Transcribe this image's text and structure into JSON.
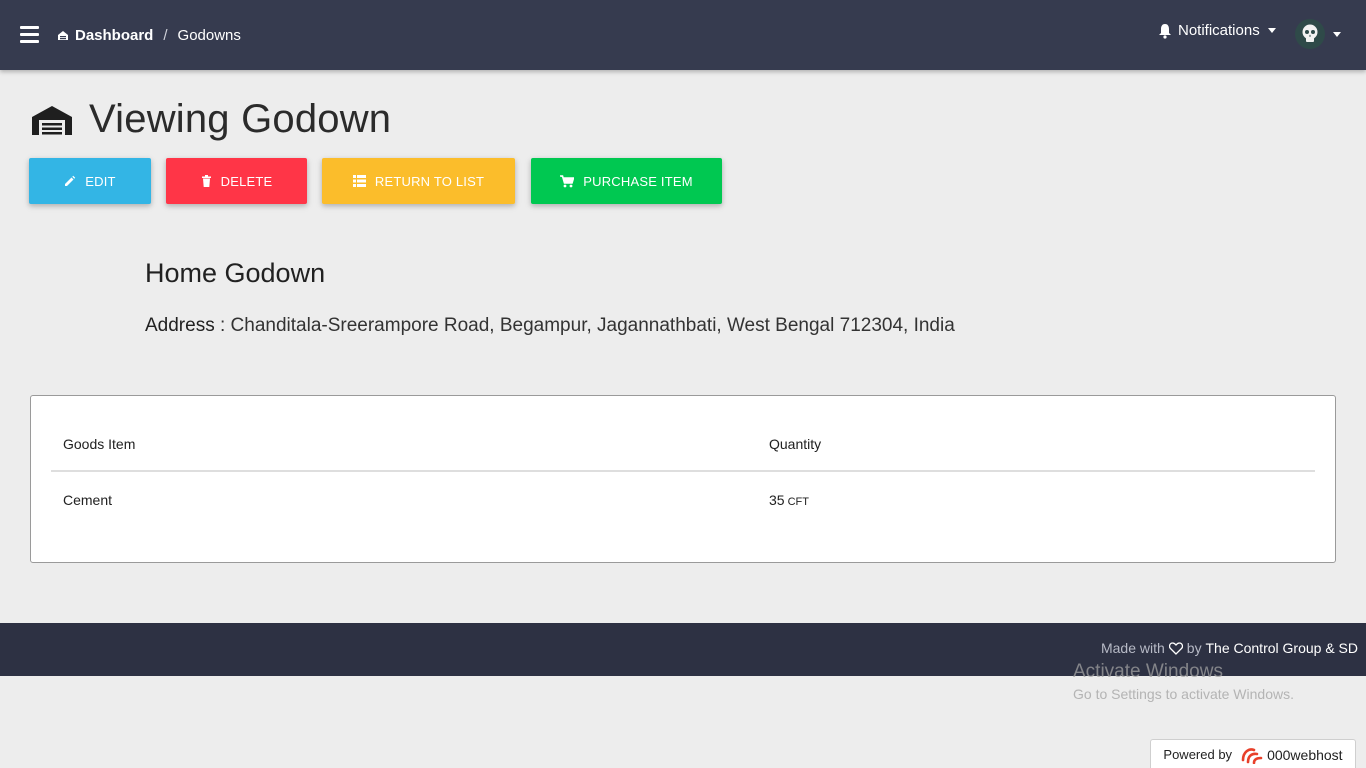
{
  "navbar": {
    "breadcrumb_home": "Dashboard",
    "breadcrumb_separator": "/",
    "breadcrumb_current": "Godowns",
    "notifications_label": "Notifications",
    "icons": [
      "menu-icon",
      "home-icon",
      "bell-icon",
      "skull-avatar"
    ]
  },
  "page": {
    "title": "Viewing Godown",
    "icon": "warehouse-icon"
  },
  "actions": {
    "edit_label": "EDIT",
    "delete_label": "DELETE",
    "return_label": "RETURN TO LIST",
    "purchase_label": "PURCHASE ITEM",
    "colors": {
      "edit": "#33b5e5",
      "delete": "#ff3547",
      "return": "#fbbd2b",
      "purchase": "#00c851"
    }
  },
  "godown": {
    "name": "Home Godown",
    "address_label": "Address",
    "address_separator": ":",
    "address_value": "Chanditala-Sreerampore Road, Begampur, Jagannathbati, West Bengal 712304, India"
  },
  "table": {
    "headers": [
      "Goods Item",
      "Quantity"
    ],
    "rows": [
      {
        "item": "Cement",
        "quantity": "35",
        "unit": "CFT"
      }
    ]
  },
  "footer": {
    "made_with": "Made with",
    "by": "by",
    "team": "The Control Group & SD"
  },
  "watermark": {
    "title": "Activate Windows",
    "subtitle": "Go to Settings to activate Windows."
  },
  "powered": {
    "label": "Powered by",
    "brand": "000webhost"
  }
}
